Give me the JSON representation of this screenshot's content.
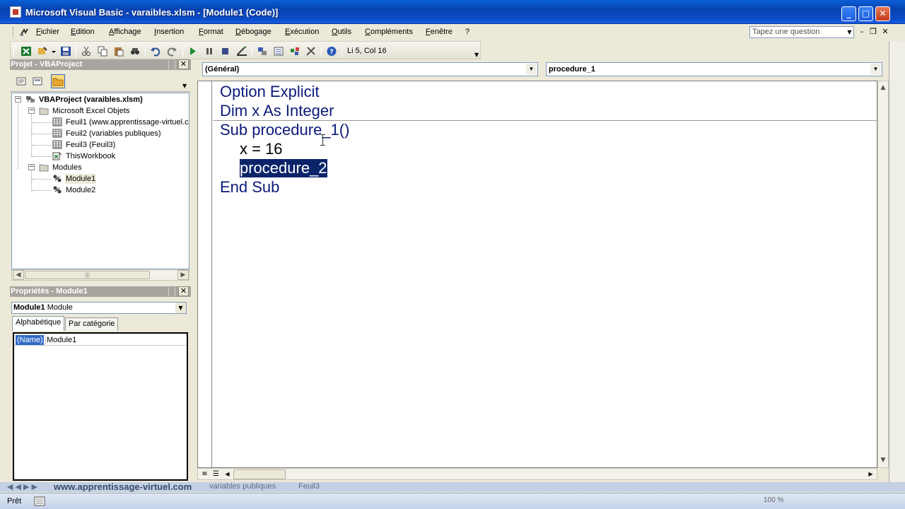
{
  "window": {
    "title": "Microsoft Visual Basic - varaibles.xlsm - [Module1 (Code)]",
    "min_glyph": "_",
    "max_glyph": "□",
    "close_glyph": "✕"
  },
  "menu": {
    "items": [
      "Fichier",
      "Edition",
      "Affichage",
      "Insertion",
      "Format",
      "Débogage",
      "Exécution",
      "Outils",
      "Compléments",
      "Fenêtre",
      "?"
    ],
    "search_placeholder": "Tapez une question"
  },
  "toolbar": {
    "position": "Li 5, Col 16"
  },
  "project_pane": {
    "title": "Projet - VBAProject",
    "tree": {
      "root": "VBAProject (varaibles.xlsm)",
      "excel_objects": "Microsoft Excel Objets",
      "sheets": [
        "Feuil1 (www.apprentissage-virtuel.c",
        "Feuil2 (variables publiques)",
        "Feuil3 (Feuil3)",
        "ThisWorkbook"
      ],
      "modules_folder": "Modules",
      "modules": [
        "Module1",
        "Module2"
      ]
    }
  },
  "properties_pane": {
    "title": "Propriétés - Module1",
    "object_name": "Module1",
    "object_type": "Module",
    "tabs": [
      "Alphabétique",
      "Par catégorie"
    ],
    "prop_name": "(Name)",
    "prop_value": "Module1"
  },
  "code": {
    "object_combo": "(Général)",
    "proc_combo": "procedure_1",
    "lines": {
      "l1": "Option Explicit",
      "l2": "Dim x As Integer",
      "l3": "Sub procedure_1()",
      "l4": "x = 16",
      "l5": "procedure_2",
      "l6": "End Sub"
    }
  },
  "excel": {
    "sheet_tabs": [
      "www.apprentissage-virtuel.com",
      "variables publiques",
      "Feuil3"
    ],
    "status": "Prêt",
    "zoom": "100 %"
  },
  "colors": {
    "titlebar": "#0a4cc8",
    "keyword": "#0b1a7a",
    "selection": "#0a246a"
  }
}
